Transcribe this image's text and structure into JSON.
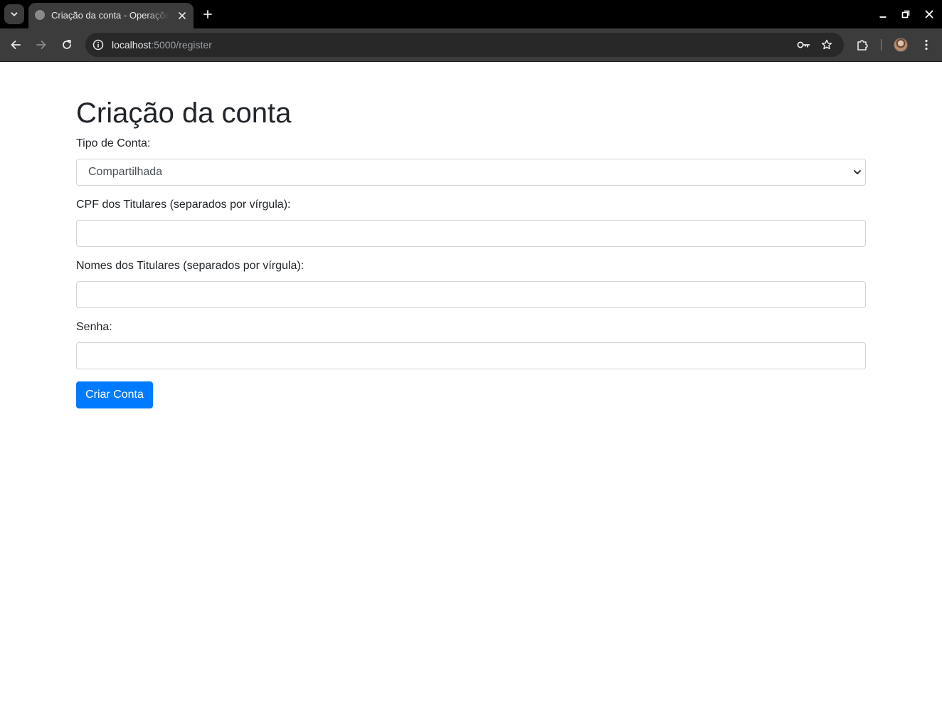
{
  "browser": {
    "tab_title": "Criação da conta - Operações",
    "url_host": "localhost",
    "url_rest": ":5000/register",
    "icons": {
      "tab_menu": "chevron-down-icon",
      "favicon": "globe-icon",
      "tab_close": "close-icon",
      "new_tab": "plus-icon",
      "back": "arrow-left-icon",
      "forward": "arrow-right-icon",
      "reload": "reload-icon",
      "site_info": "info-icon",
      "password": "key-icon",
      "bookmark": "star-icon",
      "extensions": "puzzle-icon",
      "menu": "kebab-menu-icon",
      "minimize": "minimize-icon",
      "maximize": "restore-icon",
      "close_window": "close-icon"
    }
  },
  "form": {
    "title": "Criação da conta",
    "account_type_label": "Tipo de Conta:",
    "account_type_value": "Compartilhada",
    "cpf_label": "CPF dos Titulares (separados por vírgula):",
    "cpf_value": "",
    "names_label": "Nomes dos Titulares (separados por vírgula):",
    "names_value": "",
    "password_label": "Senha:",
    "password_value": "",
    "submit_label": "Criar Conta"
  },
  "colors": {
    "primary": "#007bff",
    "text": "#212529",
    "input_border": "#ced4da",
    "chrome_dark": "#3c3c3c",
    "titlebar": "#000000"
  }
}
